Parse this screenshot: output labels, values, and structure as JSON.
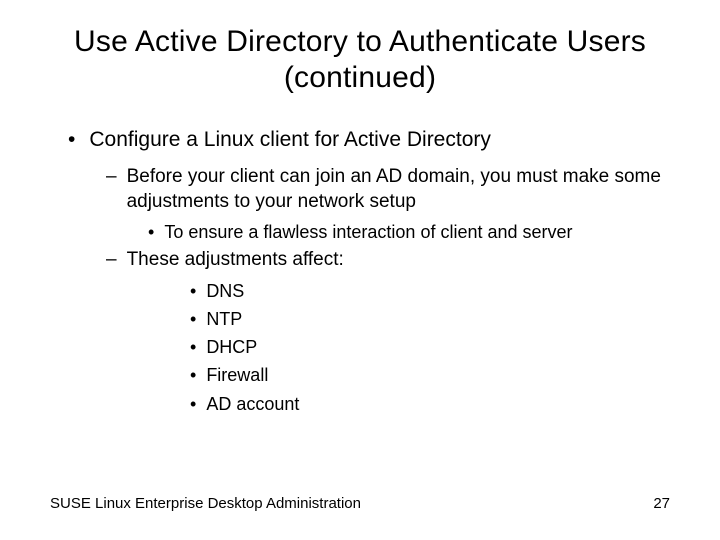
{
  "title": "Use Active Directory to Authenticate Users (continued)",
  "l1": {
    "marker": "•",
    "text": "Configure a Linux client for Active Directory"
  },
  "l2a": {
    "marker": "–",
    "text": "Before your client can join an AD domain, you must make some adjustments to your network setup"
  },
  "l3a": {
    "marker": "•",
    "text": "To ensure a flawless interaction of client and server"
  },
  "l2b": {
    "marker": "–",
    "text": "These adjustments affect:"
  },
  "items": {
    "marker": "•",
    "i0": "DNS",
    "i1": "NTP",
    "i2": "DHCP",
    "i3": "Firewall",
    "i4": "AD account"
  },
  "footer": {
    "left": "SUSE Linux Enterprise Desktop Administration",
    "right": "27"
  }
}
